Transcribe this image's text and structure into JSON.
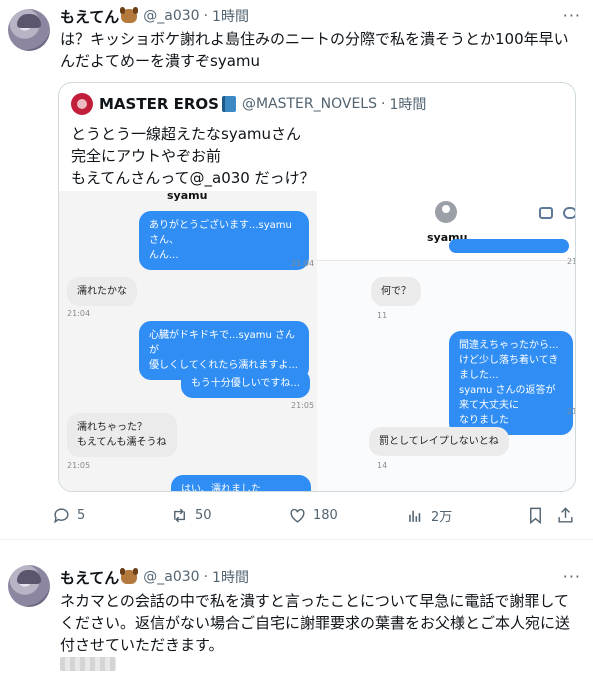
{
  "tweets": [
    {
      "display_name": "もえてん",
      "handle": "@_a030",
      "separator": "·",
      "time": "1時間",
      "more": "···",
      "text": "は？キッショボケ謝れよ島住みのニートの分際で私を潰そうとか100年早いんだよてめーを潰すぞsyamu",
      "quote": {
        "display_name": "MASTER EROS",
        "handle": "@MASTER_NOVELS",
        "separator": "·",
        "time": "1時間",
        "text_lines": [
          "とうとう一線超えたなsyamuさん",
          "完全にアウトやぞお前",
          "もえてんさんって@_a030 だっけ？"
        ],
        "screenshot_left": {
          "title": "syamu",
          "messages": [
            {
              "side": "out",
              "text": "ありがとうございます...syamu さん、",
              "text2": "んん..."
            },
            {
              "side": "in",
              "text": "濡れたかな"
            },
            {
              "side": "out",
              "text": "心臓がドキドキで...syamu さんが",
              "text2": "優しくしてくれたら濡れますよ..."
            },
            {
              "side": "out",
              "text": "もう十分優しいですね..."
            },
            {
              "side": "in",
              "text": "濡れちゃった？",
              "text2": "もえてんも濡そうね"
            },
            {
              "side": "out",
              "text": "はい、濡れました"
            }
          ],
          "timestamps": [
            "21:04",
            "21:04",
            "21:05",
            "21:05"
          ]
        },
        "screenshot_right": {
          "title": "syamu",
          "messages": [
            {
              "side": "in",
              "text": "何で？"
            },
            {
              "side": "out",
              "text": "間違えちゃったから...",
              "text2": "けど少し落ち着いてきました...",
              "text3": "syamu さんの返答が来て大丈夫に",
              "text4": "なりました"
            },
            {
              "side": "in",
              "text": "罰としてレイプしないとね"
            }
          ],
          "timestamps": [
            "21",
            "11",
            "21",
            "14"
          ]
        }
      },
      "actions": {
        "replies": "5",
        "retweets": "50",
        "likes": "180",
        "views": "2万"
      }
    },
    {
      "display_name": "もえてん",
      "handle": "@_a030",
      "separator": "·",
      "time": "1時間",
      "more": "···",
      "text": "ネカマとの会話の中で私を潰すと言ったことについて早急に電話で謝罪してください。返信がない場合ご自宅に謝罪要求の葉書をお父様とご本人宛に送付させていただきます。"
    }
  ],
  "colors": {
    "text": "#0f1419",
    "secondary": "#536471",
    "border": "#cfd9de",
    "bubble_blue": "#2f8df4"
  },
  "icons": [
    "reply-icon",
    "retweet-icon",
    "like-icon",
    "views-icon",
    "bookmark-icon",
    "share-icon"
  ]
}
